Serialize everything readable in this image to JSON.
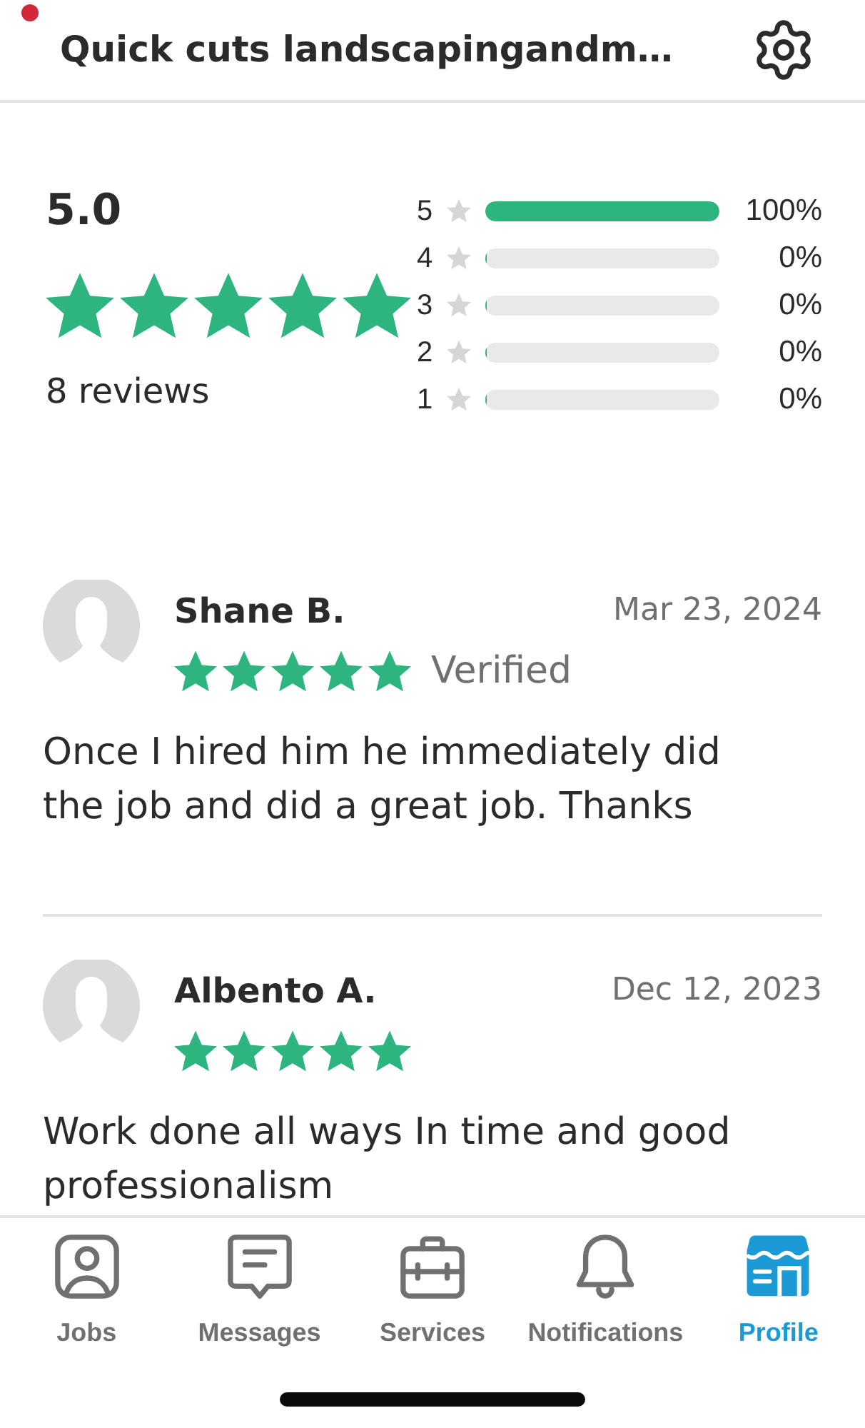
{
  "header": {
    "title": "Quick cuts landscapingandm…",
    "notification_dot": true
  },
  "summary": {
    "average": "5.0",
    "stars": 5,
    "count": "8 reviews"
  },
  "distribution": [
    {
      "label": "5",
      "level": 1,
      "percent": "100%"
    },
    {
      "label": "4",
      "level": 0,
      "percent": "0%"
    },
    {
      "label": "3",
      "level": 0,
      "percent": "0%"
    },
    {
      "label": "2",
      "level": 0,
      "percent": "0%"
    },
    {
      "label": "1",
      "level": 0,
      "percent": "0%"
    }
  ],
  "reviews": [
    {
      "name": "Shane B.",
      "date": "Mar 23, 2024",
      "stars": 5,
      "verified_label": "Verified",
      "text": "Once I hired him he immediately did the job and did a great job. Thanks"
    },
    {
      "name": "Albento A.",
      "date": "Dec 12, 2023",
      "stars": 5,
      "text": "Work done all ways In time and good professionalism"
    }
  ],
  "tab_bar": [
    {
      "label": "Jobs",
      "selected": false
    },
    {
      "label": "Messages",
      "selected": false
    },
    {
      "label": "Services",
      "selected": false
    },
    {
      "label": "Notifications",
      "selected": false
    },
    {
      "label": "Profile",
      "selected": true
    }
  ]
}
